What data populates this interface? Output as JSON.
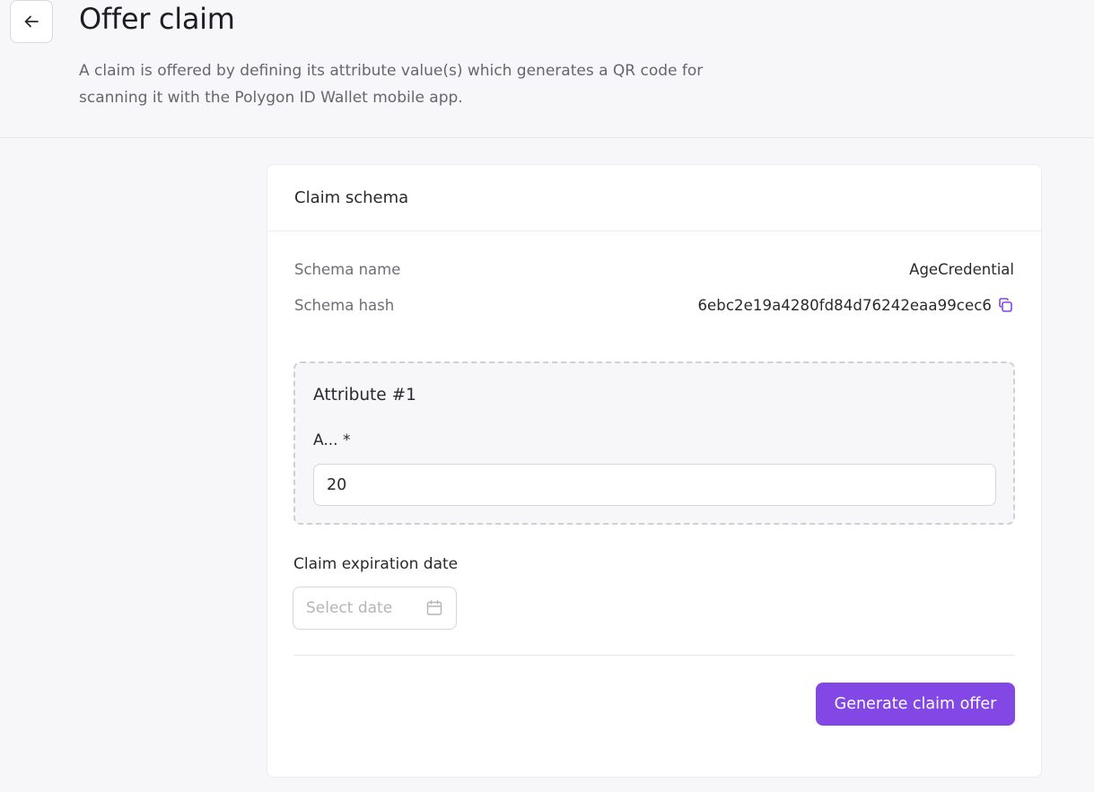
{
  "header": {
    "title": "Offer claim",
    "description": "A claim is offered by defining its attribute value(s) which generates a QR code for scanning it with the Polygon ID Wallet mobile app."
  },
  "icons": {
    "back": "arrow-left-icon",
    "copy": "copy-icon",
    "calendar": "calendar-icon"
  },
  "colors": {
    "accent": "#8247e5",
    "background": "#f7f7f9",
    "card": "#ffffff"
  },
  "card": {
    "title": "Claim schema",
    "schema_name_label": "Schema name",
    "schema_name_value": "AgeCredential",
    "schema_hash_label": "Schema hash",
    "schema_hash_value": "6ebc2e19a4280fd84d76242eaa99cec6"
  },
  "attribute": {
    "title": "Attribute #1",
    "field_label": "A... *",
    "field_value": "20"
  },
  "expiration": {
    "label": "Claim expiration date",
    "placeholder": "Select date"
  },
  "actions": {
    "generate_label": "Generate claim offer"
  }
}
